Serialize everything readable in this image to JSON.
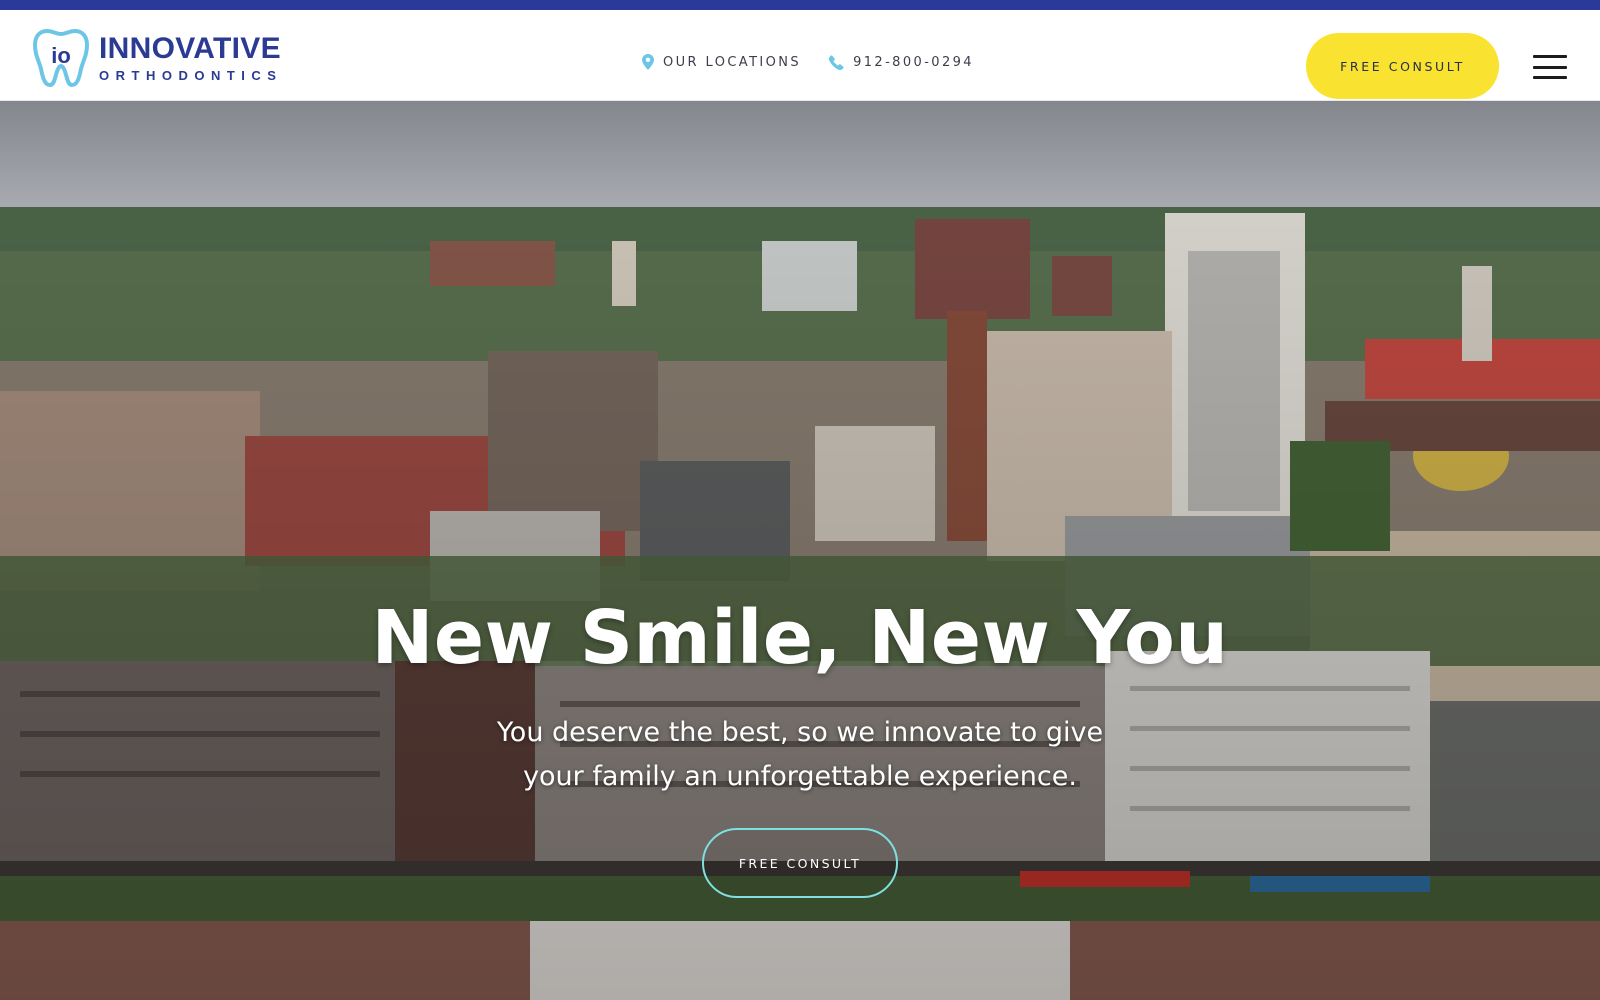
{
  "brand": {
    "logo_mark": "io",
    "name": "INNOVATIVE",
    "subtitle": "ORTHODONTICS",
    "color": "#2b3a93",
    "accent": "#6ec6e6"
  },
  "header": {
    "locations_label": "OUR LOCATIONS",
    "locations_icon": "map-pin-icon",
    "phone": "912-800-0294",
    "phone_icon": "phone-icon",
    "cta_label": "FREE CONSULT",
    "cta_color": "#f9e230",
    "menu_icon": "hamburger-menu-icon"
  },
  "hero": {
    "title": "New Smile, New You",
    "subtitle_line1": "You deserve the best, so we innovate to give",
    "subtitle_line2": "your family an unforgettable experience.",
    "cta_label": "FREE CONSULT",
    "cta_border_color": "#7fe0e0"
  },
  "colors": {
    "top_bar": "#2a3a9b"
  }
}
